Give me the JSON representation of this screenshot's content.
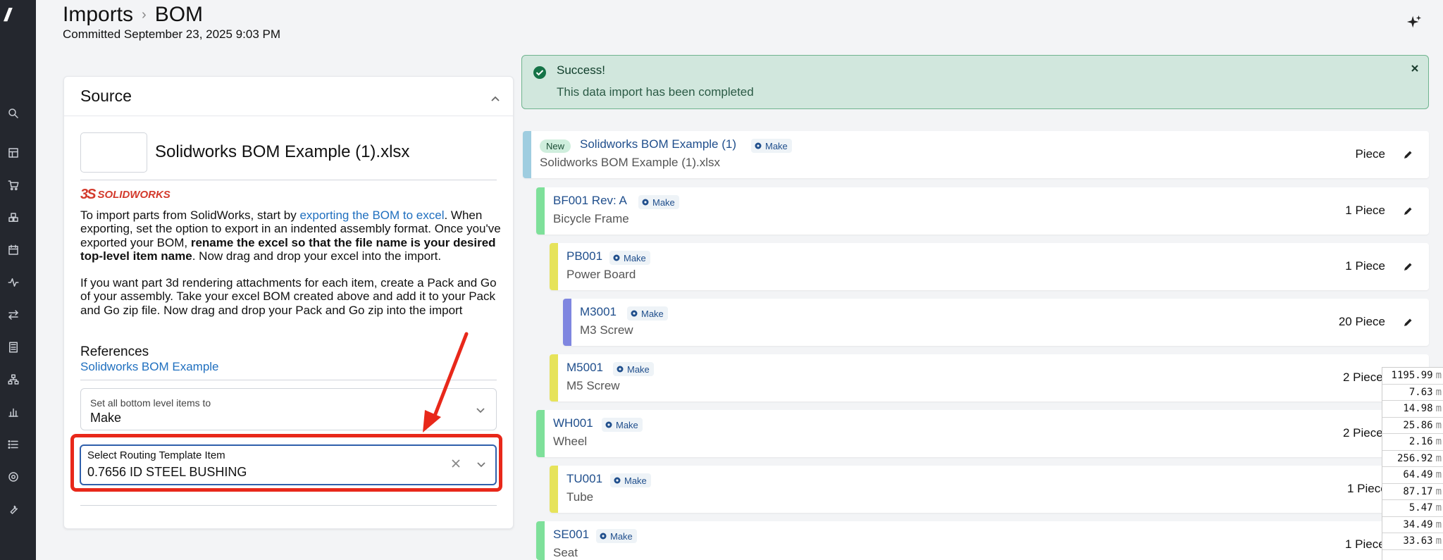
{
  "header": {
    "breadcrumb_root": "Imports",
    "breadcrumb_separator": "›",
    "breadcrumb_current": "BOM",
    "committed": "Committed September 23, 2025 9:03 PM"
  },
  "source": {
    "title": "Source",
    "file_name": "Solidworks BOM Example (1).xlsx",
    "logo_text": "SOLIDWORKS",
    "logo_mark": "3S",
    "p1_a": "To import parts from SolidWorks, start by ",
    "p1_link": "exporting the BOM to excel",
    "p1_b": ". When exporting, set the option to export in an indented assembly format. Once you've exported your BOM, ",
    "p1_bold": "rename the excel so that the file name is your desired top-level item name",
    "p1_c": ". Now drag and drop your excel into the import.",
    "p2": "If you want part 3d rendering attachments for each item, create a Pack and Go of your assembly. Take your excel BOM created above and add it to your Pack and Go zip file. Now drag and drop your Pack and Go zip into the import",
    "references_heading": "References",
    "references_link": "Solidworks BOM Example",
    "bottom_level_label": "Set all bottom level items to",
    "bottom_level_value": "Make",
    "routing_label": "Select Routing Template Item",
    "routing_value": "0.7656 ID STEEL BUSHING"
  },
  "alert": {
    "title": "Success!",
    "message": "This data import has been completed"
  },
  "bom": {
    "new_badge": "New",
    "make_label": "Make",
    "rows": [
      {
        "code": "Solidworks BOM Example (1)",
        "name": "Solidworks BOM Example (1).xlsx",
        "qty": "Piece",
        "color": "#9fcde0"
      },
      {
        "code": "BF001  Rev: A",
        "name": "Bicycle Frame",
        "qty": "1 Piece",
        "color": "#7ee09a"
      },
      {
        "code": "PB001",
        "name": "Power Board",
        "qty": "1 Piece",
        "color": "#e6e35a"
      },
      {
        "code": "M3001",
        "name": "M3 Screw",
        "qty": "20 Piece",
        "color": "#7f86e0"
      },
      {
        "code": "M5001",
        "name": "M5 Screw",
        "qty": "2 Piece",
        "color": "#e6e35a"
      },
      {
        "code": "WH001",
        "name": "Wheel",
        "qty": "2 Piece",
        "color": "#7ee09a"
      },
      {
        "code": "TU001",
        "name": "Tube",
        "qty": "1 Piece",
        "color": "#e6e35a"
      },
      {
        "code": "SE001",
        "name": "Seat",
        "qty": "1 Piece",
        "color": "#7ee09a"
      }
    ]
  },
  "numbers_panel": {
    "unit": "m",
    "values": [
      "1195.99",
      "7.63",
      "14.98",
      "25.86",
      "2.16",
      "256.92",
      "64.49",
      "87.17",
      "5.47",
      "34.49",
      "33.63"
    ]
  }
}
